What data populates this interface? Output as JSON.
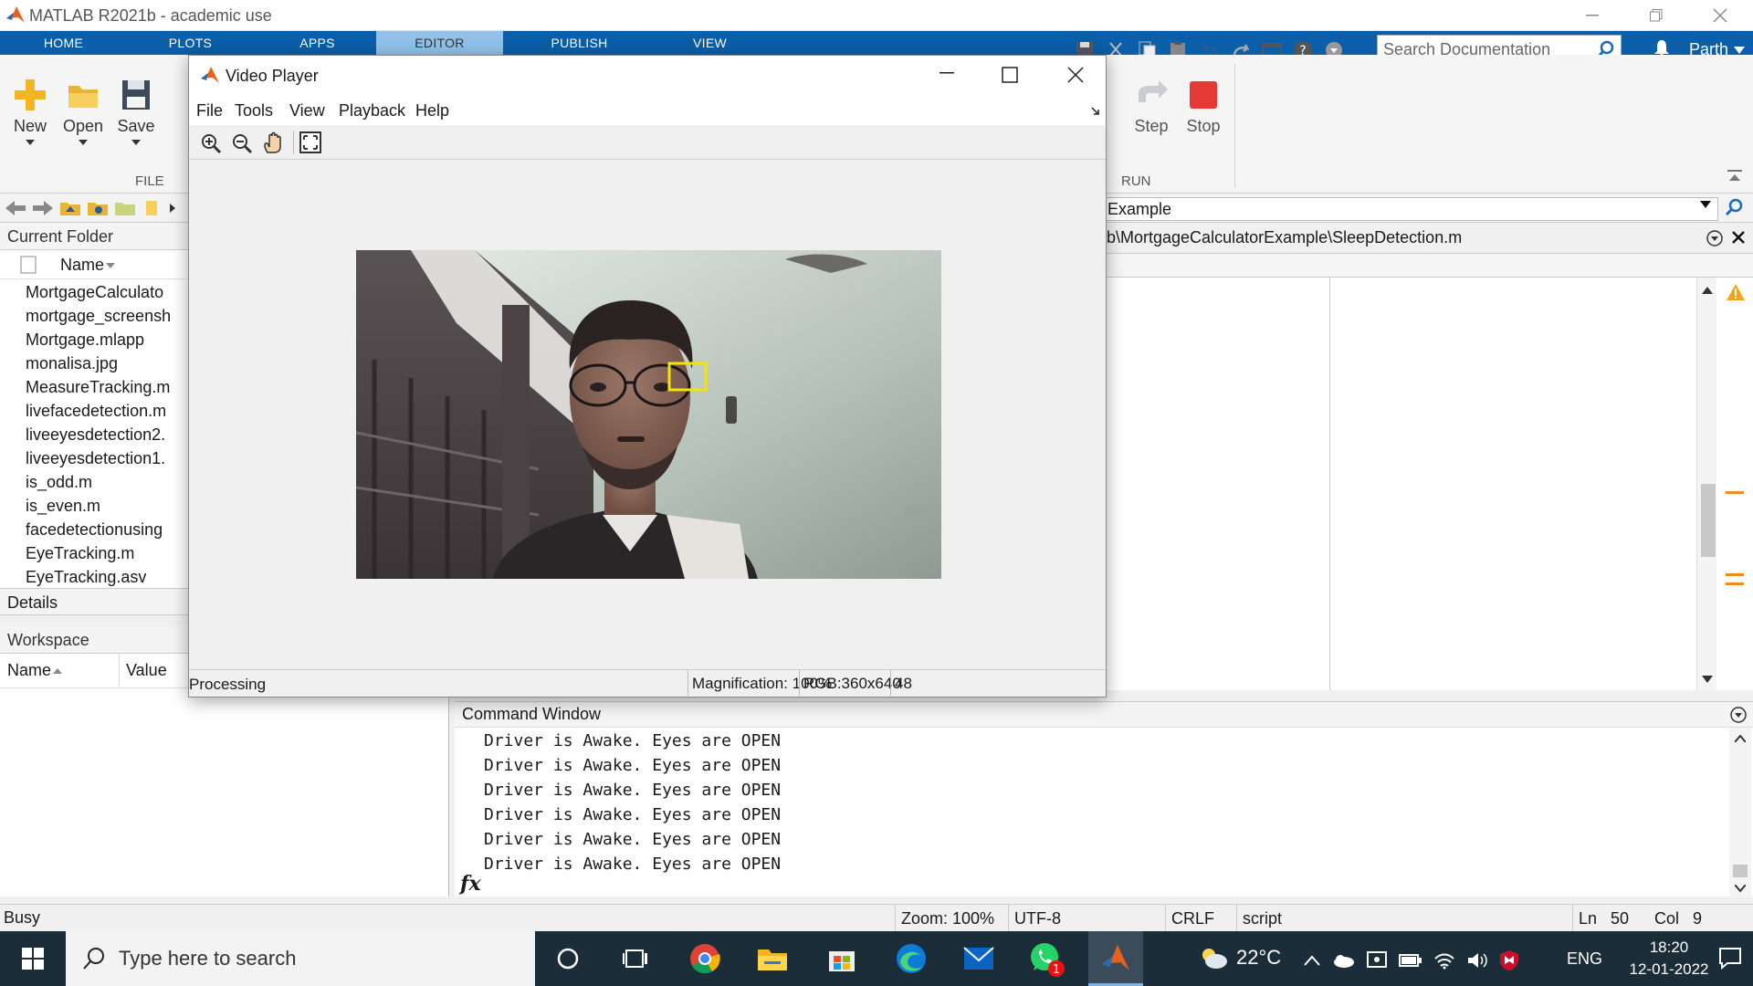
{
  "app": {
    "title": "MATLAB R2021b - academic use",
    "user": "Parth"
  },
  "tabs": [
    "HOME",
    "PLOTS",
    "APPS",
    "EDITOR",
    "PUBLISH",
    "VIEW"
  ],
  "ribbon": {
    "new": "New",
    "open": "Open",
    "save": "Save",
    "file_group": "FILE",
    "step": "Step",
    "stop": "Stop",
    "run_group": "RUN"
  },
  "search": {
    "placeholder": "Search Documentation"
  },
  "address": {
    "value": "Example"
  },
  "editor": {
    "file_path": "b\\MortgageCalculatorExample\\SleepDetection.m"
  },
  "current_folder": {
    "title": "Current Folder",
    "col_name": "Name",
    "files": [
      "MortgageCalculato",
      "mortgage_screensh",
      "Mortgage.mlapp",
      "monalisa.jpg",
      "MeasureTracking.m",
      "livefacedetection.m",
      "liveeyesdetection2.",
      "liveeyesdetection1.",
      "is_odd.m",
      "is_even.m",
      "facedetectionusing",
      "EyeTracking.m",
      "EyeTracking.asv"
    ]
  },
  "details": {
    "title": "Details"
  },
  "workspace": {
    "title": "Workspace",
    "col_name": "Name",
    "col_value": "Value"
  },
  "command_window": {
    "title": "Command Window",
    "lines": [
      "Driver is Awake. Eyes are OPEN",
      "Driver is Awake. Eyes are OPEN",
      "Driver is Awake. Eyes are OPEN",
      "Driver is Awake. Eyes are OPEN",
      "Driver is Awake. Eyes are OPEN",
      "Driver is Awake. Eyes are OPEN"
    ],
    "prompt": "fx"
  },
  "video_player": {
    "title": "Video Player",
    "menu": [
      "File",
      "Tools",
      "View",
      "Playback",
      "Help"
    ],
    "status": "Processing",
    "magnification": "Magnification: 100%",
    "format": "RGB:360x640",
    "frame": "48"
  },
  "statusbar": {
    "state": "Busy",
    "zoom": "Zoom: 100%",
    "encoding": "UTF-8",
    "eol": "CRLF",
    "type": "script",
    "ln_label": "Ln",
    "ln": "50",
    "col_label": "Col",
    "col": "9"
  },
  "taskbar": {
    "search_placeholder": "Type here to search",
    "weather": "22°C",
    "lang": "ENG",
    "time": "18:20",
    "date": "12-01-2022",
    "whatsapp_badge": "1"
  },
  "colors": {
    "accent": "#0b5ea8",
    "tab_active": "#8fc1ea",
    "detect_box": "#f2e500",
    "taskbar": "#1c2d3a"
  }
}
